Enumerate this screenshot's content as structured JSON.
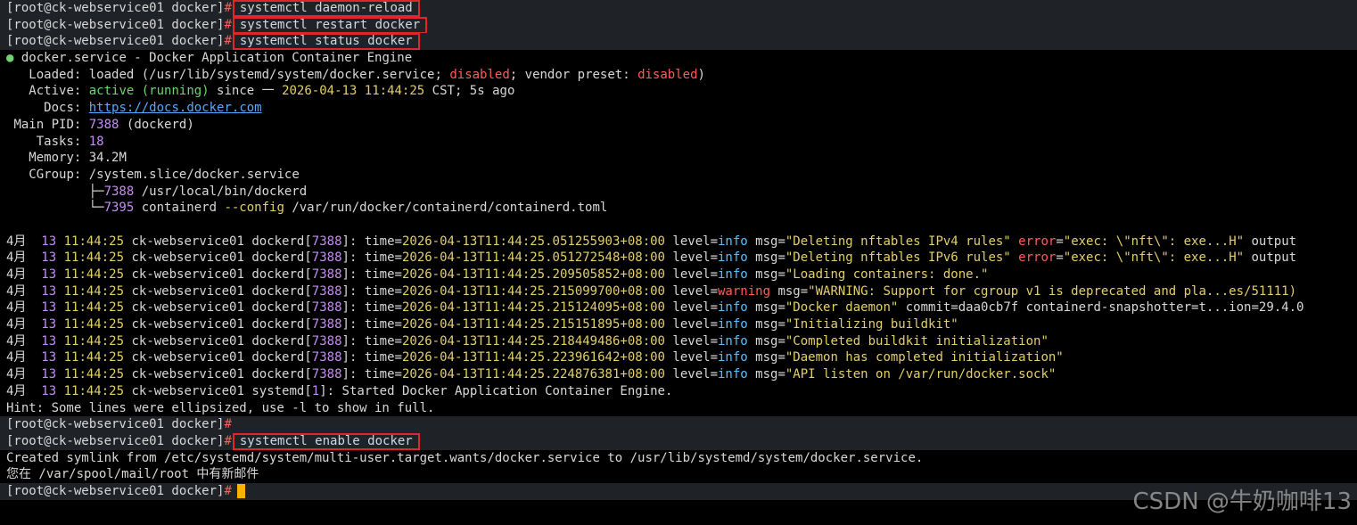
{
  "prompt": "[root@ck-webservice01 docker]",
  "prompt_hash": "#",
  "commands": {
    "daemon_reload": "systemctl daemon-reload",
    "restart": "systemctl restart docker",
    "status": "systemctl status docker",
    "enable": "systemctl enable docker"
  },
  "status": {
    "unit_line": "docker.service - Docker Application Container Engine",
    "loaded_label": "Loaded:",
    "loaded_pre": "loaded (/usr/lib/systemd/system/docker.service;",
    "disabled1": "disabled",
    "vendor_pre": "; vendor preset:",
    "disabled2": "disabled",
    "loaded_close": ")",
    "active_label": "Active:",
    "active_state": "active (running)",
    "active_since": "since 一",
    "active_time": "2026-04-13 11:44:25",
    "active_tail": "CST; 5s ago",
    "docs_label": "Docs:",
    "docs_url": "https://docs.docker.com",
    "pid_label": "Main PID:",
    "pid_value": "7388",
    "pid_name": "(dockerd)",
    "tasks_label": "Tasks:",
    "tasks_value": "18",
    "memory_label": "Memory:",
    "memory_value": "34.2M",
    "cgroup_label": "CGroup:",
    "cgroup_value": "/system.slice/docker.service",
    "proc1_prefix": "├─",
    "proc1_pid": "7388",
    "proc1_cmd": " /usr/local/bin/dockerd",
    "proc2_prefix": "└─",
    "proc2_pid": "7395",
    "proc2_cmd_a": " containerd ",
    "proc2_flag": "--config",
    "proc2_cmd_b": " /var/run/docker/containerd/containerd.toml"
  },
  "logs": [
    {
      "time": "2026-04-13T11:44:25.051255903+08:00",
      "level": "info",
      "msg": "\"Deleting nftables IPv4 rules\"",
      "extra_key": " error",
      "extra_val": "\"exec: \\\"nft\\\": exe...H\"",
      "tail": " output"
    },
    {
      "time": "2026-04-13T11:44:25.051272548+08:00",
      "level": "info",
      "msg": "\"Deleting nftables IPv6 rules\"",
      "extra_key": " error",
      "extra_val": "\"exec: \\\"nft\\\": exe...H\"",
      "tail": " output"
    },
    {
      "time": "2026-04-13T11:44:25.209505852+08:00",
      "level": "info",
      "msg": "\"Loading containers: done.\"",
      "extra_key": "",
      "extra_val": "",
      "tail": ""
    },
    {
      "time": "2026-04-13T11:44:25.215099700+08:00",
      "level": "warning",
      "msg": "\"WARNING: Support for cgroup v1 is deprecated and pla...es/51111)",
      "extra_key": "",
      "extra_val": "",
      "tail": ""
    },
    {
      "time": "2026-04-13T11:44:25.215124095+08:00",
      "level": "info",
      "msg": "\"Docker daemon\"",
      "extra_key": "",
      "extra_val": "",
      "tail": " commit=daa0cb7f containerd-snapshotter=t...ion=29.4.0"
    },
    {
      "time": "2026-04-13T11:44:25.215151895+08:00",
      "level": "info",
      "msg": "\"Initializing buildkit\"",
      "extra_key": "",
      "extra_val": "",
      "tail": ""
    },
    {
      "time": "2026-04-13T11:44:25.218449486+08:00",
      "level": "info",
      "msg": "\"Completed buildkit initialization\"",
      "extra_key": "",
      "extra_val": "",
      "tail": ""
    },
    {
      "time": "2026-04-13T11:44:25.223961642+08:00",
      "level": "info",
      "msg": "\"Daemon has completed initialization\"",
      "extra_key": "",
      "extra_val": "",
      "tail": ""
    },
    {
      "time": "2026-04-13T11:44:25.224876381+08:00",
      "level": "info",
      "msg": "\"API listen on /var/run/docker.sock\"",
      "extra_key": "",
      "extra_val": "",
      "tail": ""
    }
  ],
  "log_common": {
    "month": "4月",
    "day": "13",
    "clock": "11:44:25",
    "host": "ck-webservice01",
    "proc": "dockerd",
    "pid": "7388",
    "time_key": "time=",
    "level_key": "level=",
    "msg_key": "msg="
  },
  "systemd_line": {
    "proc": "systemd",
    "pid": "1",
    "text": ": Started Docker Application Container Engine."
  },
  "hint": "Hint: Some lines were ellipsized, use -l to show in full.",
  "symlink": "Created symlink from /etc/systemd/system/multi-user.target.wants/docker.service to /usr/lib/systemd/system/docker.service.",
  "mail": "您在 /var/spool/mail/root 中有新邮件",
  "watermark": "CSDN @牛奶咖啡13",
  "colors": {
    "background": "#000000",
    "highlight_box": "#e0262d",
    "active_green": "#6fd46f",
    "disabled_red": "#ff5c5c",
    "info_blue": "#56c0ff",
    "cursor": "#f4b400"
  }
}
